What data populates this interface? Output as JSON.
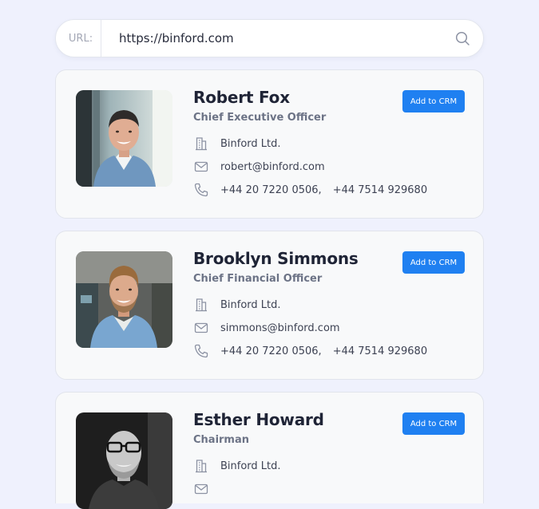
{
  "url_bar": {
    "label": "URL:",
    "value": "https://binford.com",
    "search_icon": "search-icon"
  },
  "contacts": [
    {
      "name": "Robert Fox",
      "title": "Chief Executive Officer",
      "company": "Binford Ltd.",
      "email": "robert@binford.com",
      "phone1": "+44 20 7220 0506,",
      "phone2": "+44 7514 929680",
      "button_label": "Add to CRM"
    },
    {
      "name": "Brooklyn Simmons",
      "title": "Chief Financial Officer",
      "company": "Binford Ltd.",
      "email": "simmons@binford.com",
      "phone1": "+44 20 7220 0506,",
      "phone2": "+44 7514 929680",
      "button_label": "Add to CRM"
    },
    {
      "name": "Esther Howard",
      "title": "Chairman",
      "company": "Binford Ltd.",
      "button_label": "Add to CRM"
    }
  ],
  "icons": {
    "company": "building-icon",
    "email": "mail-icon",
    "phone": "phone-icon"
  },
  "colors": {
    "background": "#eff1fd",
    "card": "#f8f9fa",
    "button": "#1f80f1",
    "name_text": "#1f2436",
    "title_text": "#6c7386"
  }
}
